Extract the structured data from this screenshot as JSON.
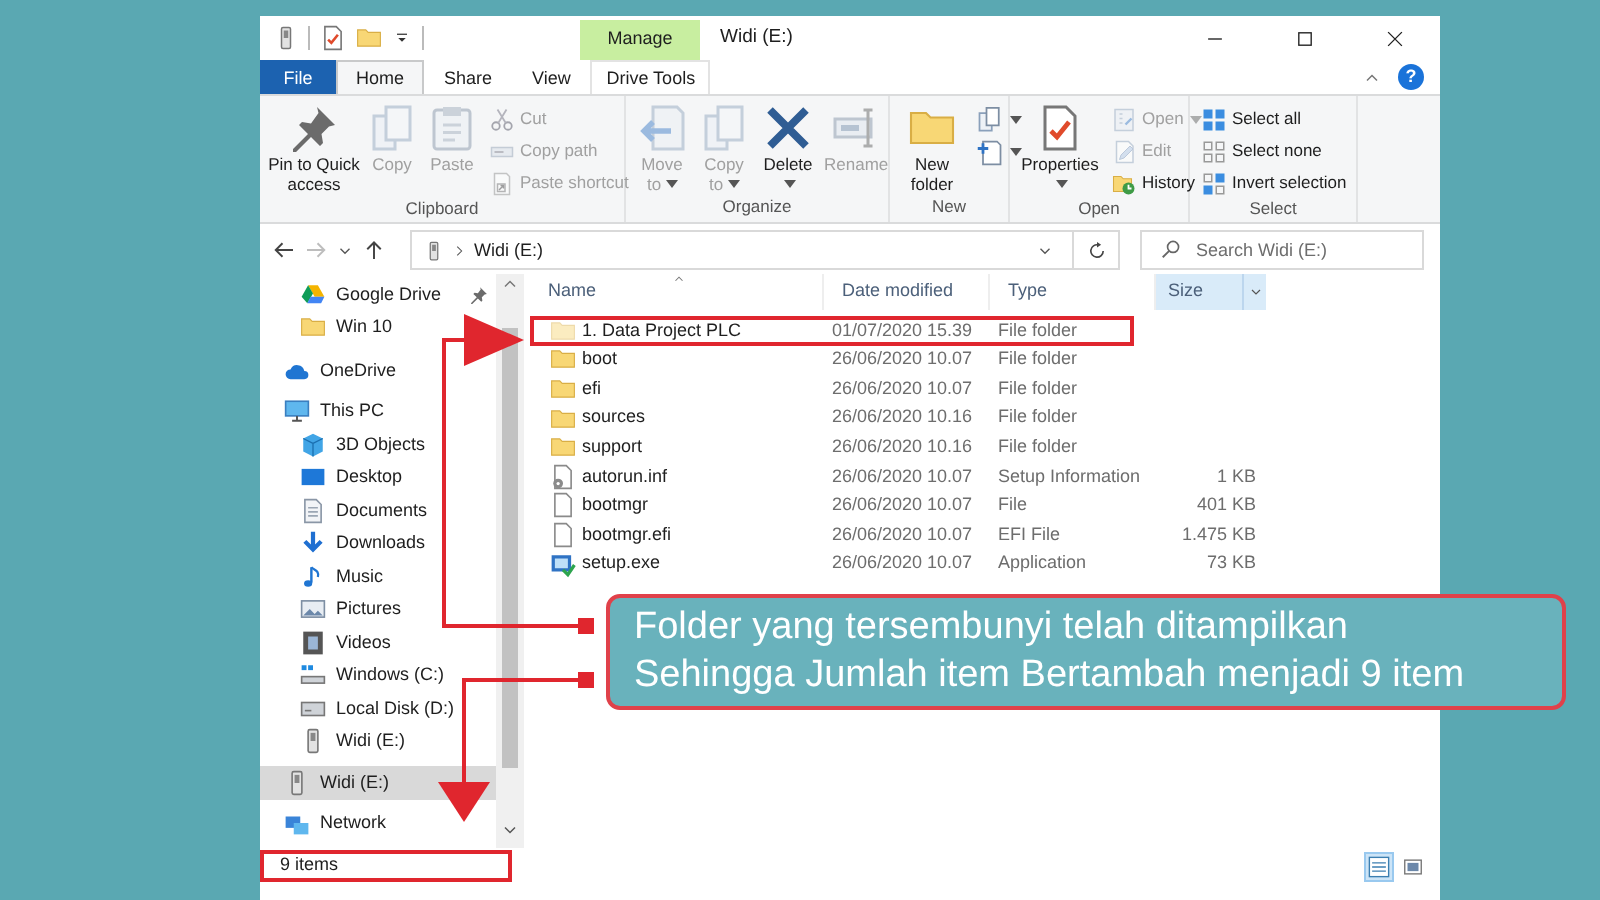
{
  "title_bar": {
    "title": "Widi (E:)",
    "contextual_header": "Manage",
    "help_button": "?"
  },
  "ribbon_tabs": [
    {
      "label": "File",
      "kind": "file",
      "selected": false
    },
    {
      "label": "Home",
      "kind": "tab",
      "selected": true
    },
    {
      "label": "Share",
      "kind": "tab",
      "selected": false
    },
    {
      "label": "View",
      "kind": "tab",
      "selected": false
    },
    {
      "label": "Drive Tools",
      "kind": "contextual",
      "selected": false
    }
  ],
  "ribbon_groups": [
    {
      "label": "Clipboard",
      "commands": [
        {
          "label": "Pin to Quick access",
          "kind": "large",
          "disabled": false
        },
        {
          "label": "Copy",
          "kind": "large",
          "disabled": true
        },
        {
          "label": "Paste",
          "kind": "large",
          "disabled": true
        },
        {
          "label": "Cut",
          "kind": "small",
          "disabled": true
        },
        {
          "label": "Copy path",
          "kind": "small",
          "disabled": true
        },
        {
          "label": "Paste shortcut",
          "kind": "small",
          "disabled": true
        }
      ]
    },
    {
      "label": "Organize",
      "commands": [
        {
          "label": "Move to",
          "kind": "large",
          "disabled": true,
          "dropdown": true
        },
        {
          "label": "Copy to",
          "kind": "large",
          "disabled": true,
          "dropdown": true
        },
        {
          "label": "Delete",
          "kind": "large",
          "disabled": false,
          "dropdown": true
        },
        {
          "label": "Rename",
          "kind": "large",
          "disabled": true
        }
      ]
    },
    {
      "label": "New",
      "commands": [
        {
          "label": "New folder",
          "kind": "large",
          "disabled": false
        },
        {
          "kind": "icon",
          "disabled": false,
          "dropdown": true
        },
        {
          "kind": "icon",
          "disabled": false,
          "dropdown": true
        }
      ]
    },
    {
      "label": "Open",
      "commands": [
        {
          "label": "Properties",
          "kind": "large",
          "disabled": false,
          "dropdown": true
        },
        {
          "label": "Open",
          "kind": "small",
          "disabled": true,
          "dropdown": true
        },
        {
          "label": "Edit",
          "kind": "small",
          "disabled": true
        },
        {
          "label": "History",
          "kind": "small",
          "disabled": false
        }
      ]
    },
    {
      "label": "Select",
      "commands": [
        {
          "label": "Select all",
          "kind": "small",
          "disabled": false
        },
        {
          "label": "Select none",
          "kind": "small",
          "disabled": false
        },
        {
          "label": "Invert selection",
          "kind": "small",
          "disabled": false
        }
      ]
    }
  ],
  "navigation_buttons": [
    {
      "kind": "back",
      "disabled": false
    },
    {
      "kind": "forward",
      "disabled": true
    },
    {
      "kind": "recent",
      "disabled": false
    },
    {
      "kind": "up",
      "disabled": false
    }
  ],
  "address_bar": {
    "path": [
      "Widi (E:)"
    ],
    "search_placeholder": "Search Widi (E:)"
  },
  "sidebar": {
    "quick_access_items": [
      {
        "label": "Google Drive",
        "pinned": true,
        "selected": false
      },
      {
        "label": "Win 10",
        "pinned": false,
        "selected": false
      }
    ],
    "items": [
      {
        "label": "OneDrive",
        "selected": false
      },
      {
        "label": "This PC",
        "selected": false,
        "children": [
          {
            "label": "3D Objects",
            "selected": false
          },
          {
            "label": "Desktop",
            "selected": false
          },
          {
            "label": "Documents",
            "selected": false
          },
          {
            "label": "Downloads",
            "selected": false
          },
          {
            "label": "Music",
            "selected": false
          },
          {
            "label": "Pictures",
            "selected": false
          },
          {
            "label": "Videos",
            "selected": false
          },
          {
            "label": "Windows (C:)",
            "selected": false
          },
          {
            "label": "Local Disk (D:)",
            "selected": false
          },
          {
            "label": "Widi (E:)",
            "selected": false
          }
        ]
      },
      {
        "label": "Widi (E:)",
        "selected": true
      },
      {
        "label": "Network",
        "selected": false
      }
    ]
  },
  "file_list": {
    "columns": [
      {
        "label": "Name",
        "sorted": true,
        "hovered": false
      },
      {
        "label": "Date modified",
        "sorted": false,
        "hovered": false
      },
      {
        "label": "Type",
        "sorted": false,
        "hovered": false
      },
      {
        "label": "Size",
        "sorted": false,
        "hovered": true
      }
    ],
    "rows": [
      {
        "kind": "folder",
        "name": "1. Data Project PLC",
        "date_modified": "01/07/2020 15.39",
        "type": "File folder",
        "hidden": true,
        "highlighted": true
      },
      {
        "kind": "folder",
        "name": "boot",
        "date_modified": "26/06/2020 10.07",
        "type": "File folder",
        "hidden": false,
        "highlighted": false
      },
      {
        "kind": "folder",
        "name": "efi",
        "date_modified": "26/06/2020 10.07",
        "type": "File folder",
        "hidden": false,
        "highlighted": false
      },
      {
        "kind": "folder",
        "name": "sources",
        "date_modified": "26/06/2020 10.16",
        "type": "File folder",
        "hidden": false,
        "highlighted": false
      },
      {
        "kind": "folder",
        "name": "support",
        "date_modified": "26/06/2020 10.16",
        "type": "File folder",
        "hidden": false,
        "highlighted": false
      },
      {
        "kind": "settings-file",
        "name": "autorun.inf",
        "date_modified": "26/06/2020 10.07",
        "type": "Setup Information",
        "size": "1 KB",
        "hidden": false,
        "highlighted": false
      },
      {
        "kind": "file",
        "name": "bootmgr",
        "date_modified": "26/06/2020 10.07",
        "type": "File",
        "size": "401 KB",
        "hidden": false,
        "highlighted": false
      },
      {
        "kind": "file",
        "name": "bootmgr.efi",
        "date_modified": "26/06/2020 10.07",
        "type": "EFI File",
        "size": "1.475 KB",
        "hidden": false,
        "highlighted": false
      },
      {
        "kind": "application",
        "name": "setup.exe",
        "date_modified": "26/06/2020 10.07",
        "type": "Application",
        "size": "73 KB",
        "hidden": false,
        "highlighted": false
      }
    ]
  },
  "status_bar": {
    "item_count": "9 items",
    "highlighted": true,
    "view_buttons": [
      {
        "kind": "details",
        "selected": true
      },
      {
        "kind": "large-icons",
        "selected": false
      }
    ]
  },
  "callout": {
    "lines": [
      "Folder yang tersembunyi telah ditampilkan",
      "Sehingga Jumlah item Bertambah menjadi 9 item"
    ]
  }
}
